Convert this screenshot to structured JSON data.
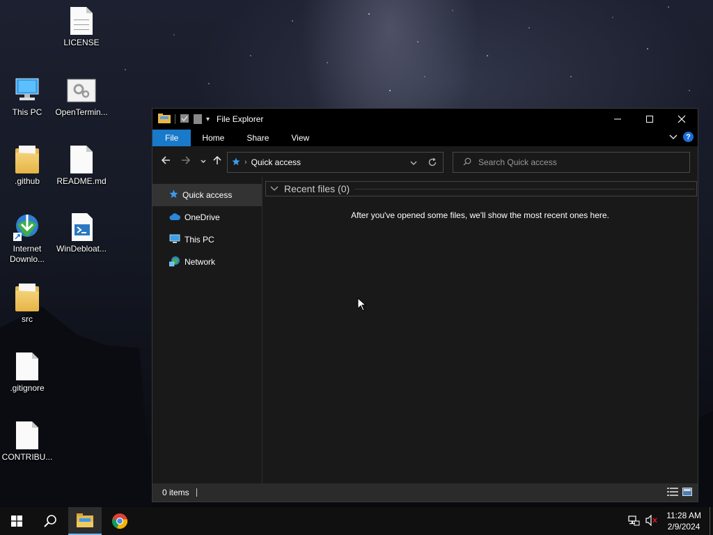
{
  "desktop": {
    "icons": [
      {
        "label": "LICENSE",
        "type": "document"
      },
      {
        "label": "This PC",
        "type": "computer"
      },
      {
        "label": "OpenTermin...",
        "type": "settings-file"
      },
      {
        "label": ".github",
        "type": "folder"
      },
      {
        "label": "README.md",
        "type": "document"
      },
      {
        "label": "Internet Downlo...",
        "type": "app-shortcut"
      },
      {
        "label": "WinDebloat...",
        "type": "powershell-script"
      },
      {
        "label": "src",
        "type": "folder"
      },
      {
        "label": ".gitignore",
        "type": "document"
      },
      {
        "label": "CONTRIBU...",
        "type": "document"
      }
    ]
  },
  "window": {
    "title": "File Explorer",
    "ribbon_tabs": [
      "File",
      "Home",
      "Share",
      "View"
    ],
    "controls": {
      "minimize": "—",
      "maximize": "☐",
      "close": "✕"
    },
    "address": {
      "location": "Quick access"
    },
    "search": {
      "placeholder": "Search Quick access"
    },
    "sidebar": {
      "items": [
        {
          "label": "Quick access",
          "icon": "star-icon",
          "selected": true
        },
        {
          "label": "OneDrive",
          "icon": "cloud-icon"
        },
        {
          "label": "This PC",
          "icon": "computer-icon"
        },
        {
          "label": "Network",
          "icon": "network-icon"
        }
      ]
    },
    "content": {
      "group_header": "Recent files (0)",
      "empty_message": "After you've opened some files, we'll show the most recent ones here."
    },
    "status": {
      "item_count": "0 items"
    }
  },
  "taskbar": {
    "time": "11:28 AM",
    "date": "2/9/2024"
  },
  "colors": {
    "accent": "#1979ca",
    "window_bg": "#191919",
    "titlebar_bg": "#000000",
    "taskbar_bg": "#101010"
  }
}
